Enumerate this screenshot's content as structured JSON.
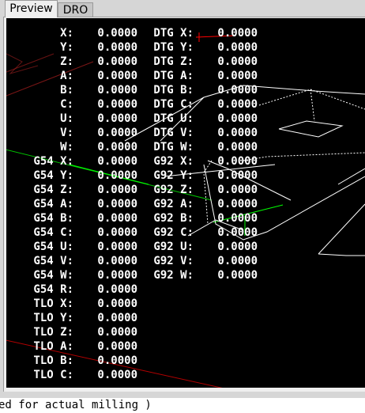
{
  "tabs": [
    {
      "label": "Preview",
      "active": true
    },
    {
      "label": "DRO",
      "active": false
    }
  ],
  "dro_left": [
    {
      "label": "X:",
      "value": "0.0000"
    },
    {
      "label": "Y:",
      "value": "0.0000"
    },
    {
      "label": "Z:",
      "value": "0.0000"
    },
    {
      "label": "A:",
      "value": "0.0000"
    },
    {
      "label": "B:",
      "value": "0.0000"
    },
    {
      "label": "C:",
      "value": "0.0000"
    },
    {
      "label": "U:",
      "value": "0.0000"
    },
    {
      "label": "V:",
      "value": "0.0000"
    },
    {
      "label": "W:",
      "value": "0.0000"
    },
    {
      "label": "G54 X:",
      "value": "0.0000"
    },
    {
      "label": "G54 Y:",
      "value": "0.0000"
    },
    {
      "label": "G54 Z:",
      "value": "0.0000"
    },
    {
      "label": "G54 A:",
      "value": "0.0000"
    },
    {
      "label": "G54 B:",
      "value": "0.0000"
    },
    {
      "label": "G54 C:",
      "value": "0.0000"
    },
    {
      "label": "G54 U:",
      "value": "0.0000"
    },
    {
      "label": "G54 V:",
      "value": "0.0000"
    },
    {
      "label": "G54 W:",
      "value": "0.0000"
    },
    {
      "label": "G54 R:",
      "value": "0.0000"
    },
    {
      "label": "TLO X:",
      "value": "0.0000"
    },
    {
      "label": "TLO Y:",
      "value": "0.0000"
    },
    {
      "label": "TLO Z:",
      "value": "0.0000"
    },
    {
      "label": "TLO A:",
      "value": "0.0000"
    },
    {
      "label": "TLO B:",
      "value": "0.0000"
    },
    {
      "label": "TLO C:",
      "value": "0.0000"
    }
  ],
  "dro_right": [
    {
      "label": "DTG X:",
      "value": "0.0000"
    },
    {
      "label": "DTG Y:",
      "value": "0.0000"
    },
    {
      "label": "DTG Z:",
      "value": "0.0000"
    },
    {
      "label": "DTG A:",
      "value": "0.0000"
    },
    {
      "label": "DTG B:",
      "value": "0.0000"
    },
    {
      "label": "DTG C:",
      "value": "0.0000"
    },
    {
      "label": "DTG U:",
      "value": "0.0000"
    },
    {
      "label": "DTG V:",
      "value": "0.0000"
    },
    {
      "label": "DTG W:",
      "value": "0.0000"
    },
    {
      "label": "G92 X:",
      "value": "0.0000"
    },
    {
      "label": "G92 Y:",
      "value": "0.0000"
    },
    {
      "label": "G92 Z:",
      "value": "0.0000"
    },
    {
      "label": "G92 A:",
      "value": "0.0000"
    },
    {
      "label": "G92 B:",
      "value": "0.0000"
    },
    {
      "label": "G92 C:",
      "value": "0.0000"
    },
    {
      "label": "G92 U:",
      "value": "0.0000"
    },
    {
      "label": "G92 V:",
      "value": "0.0000"
    },
    {
      "label": "G92 W:",
      "value": "0.0000"
    }
  ],
  "status_line": "ed for actual milling )",
  "colors": {
    "viewport_bg": "#000000",
    "dro_text": "#ffffff",
    "toolpath": "#ffffff",
    "rapid": "#ff0000",
    "axis_x": "#ff0000",
    "axis_y": "#00ff00",
    "axis_z": "#0000ff"
  }
}
